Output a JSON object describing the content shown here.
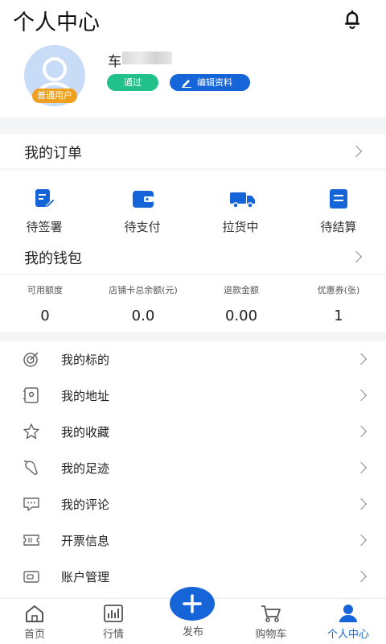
{
  "header": {
    "title": "个人中心"
  },
  "profile": {
    "username_visible": "车",
    "user_type_badge": "普通用户",
    "status": "通过",
    "edit_label": "编辑资料"
  },
  "orders": {
    "title": "我的订单",
    "items": [
      {
        "label": "待签署",
        "icon": "sign-doc-icon"
      },
      {
        "label": "待支付",
        "icon": "wallet-icon"
      },
      {
        "label": "拉货中",
        "icon": "truck-icon"
      },
      {
        "label": "待结算",
        "icon": "settlement-icon"
      }
    ]
  },
  "wallet": {
    "title": "我的钱包",
    "items": [
      {
        "label": "可用额度",
        "value": "0"
      },
      {
        "label": "店铺卡总余额(元)",
        "value": "0.0"
      },
      {
        "label": "退款金额",
        "value": "0.00"
      },
      {
        "label": "优惠券(张)",
        "value": "1"
      }
    ]
  },
  "menu": [
    {
      "label": "我的标的",
      "icon": "target-icon"
    },
    {
      "label": "我的地址",
      "icon": "address-icon"
    },
    {
      "label": "我的收藏",
      "icon": "star-icon"
    },
    {
      "label": "我的足迹",
      "icon": "footprint-icon"
    },
    {
      "label": "我的评论",
      "icon": "comment-icon"
    },
    {
      "label": "开票信息",
      "icon": "invoice-icon"
    },
    {
      "label": "账户管理",
      "icon": "account-icon"
    }
  ],
  "bottom_nav": [
    {
      "label": "首页",
      "icon": "home-icon"
    },
    {
      "label": "行情",
      "icon": "market-chart-icon"
    },
    {
      "label": "发布",
      "icon": "plus-icon"
    },
    {
      "label": "购物车",
      "icon": "cart-icon"
    },
    {
      "label": "个人中心",
      "icon": "person-icon",
      "active": true
    }
  ],
  "colors": {
    "accent": "#1565d8",
    "success": "#22c08a",
    "badge": "#f0a020"
  }
}
